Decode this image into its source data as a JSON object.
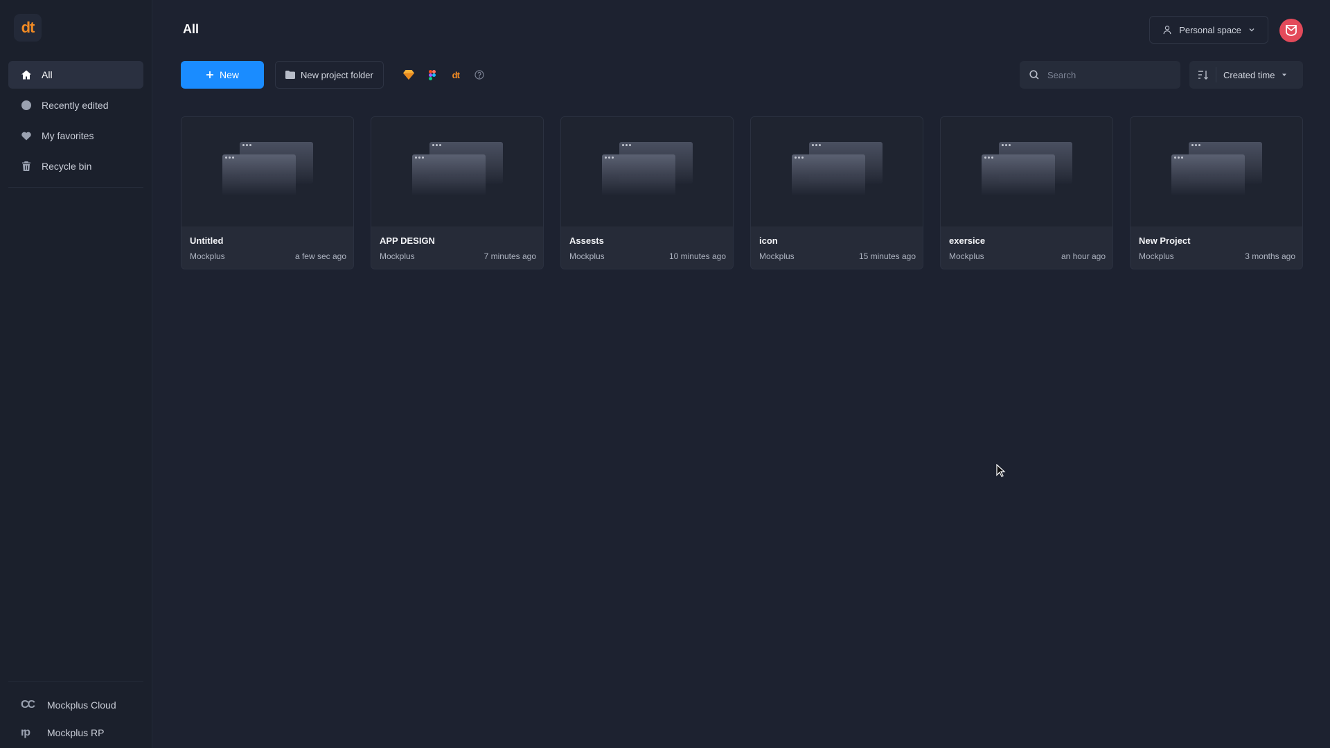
{
  "sidebar": {
    "logo": "dt",
    "nav": [
      {
        "label": "All",
        "icon": "home-icon",
        "active": true
      },
      {
        "label": "Recently edited",
        "icon": "clock-icon"
      },
      {
        "label": "My favorites",
        "icon": "heart-icon"
      },
      {
        "label": "Recycle bin",
        "icon": "trash-icon"
      }
    ],
    "bottom": [
      {
        "label": "Mockplus Cloud",
        "icon_text": "CC"
      },
      {
        "label": "Mockplus RP",
        "icon_text": "rp"
      }
    ]
  },
  "header": {
    "title": "All",
    "space_label": "Personal space"
  },
  "toolbar": {
    "new_label": "New",
    "folder_label": "New project folder",
    "import_icons": [
      "sketch-icon",
      "figma-icon",
      "dt-icon",
      "help-icon"
    ]
  },
  "search": {
    "placeholder": "Search",
    "value": ""
  },
  "sort": {
    "label": "Created time"
  },
  "projects": [
    {
      "name": "Untitled",
      "owner": "Mockplus",
      "time": "a few sec ago"
    },
    {
      "name": "APP DESIGN",
      "owner": "Mockplus",
      "time": "7 minutes ago"
    },
    {
      "name": "Assests",
      "owner": "Mockplus",
      "time": "10 minutes ago"
    },
    {
      "name": "icon",
      "owner": "Mockplus",
      "time": "15 minutes ago"
    },
    {
      "name": "exersice",
      "owner": "Mockplus",
      "time": "an hour ago"
    },
    {
      "name": "New Project",
      "owner": "Mockplus",
      "time": "3 months ago"
    }
  ],
  "colors": {
    "accent": "#1a8cff",
    "avatar": "#e34a5a",
    "logo_orange": "#f08a24"
  }
}
